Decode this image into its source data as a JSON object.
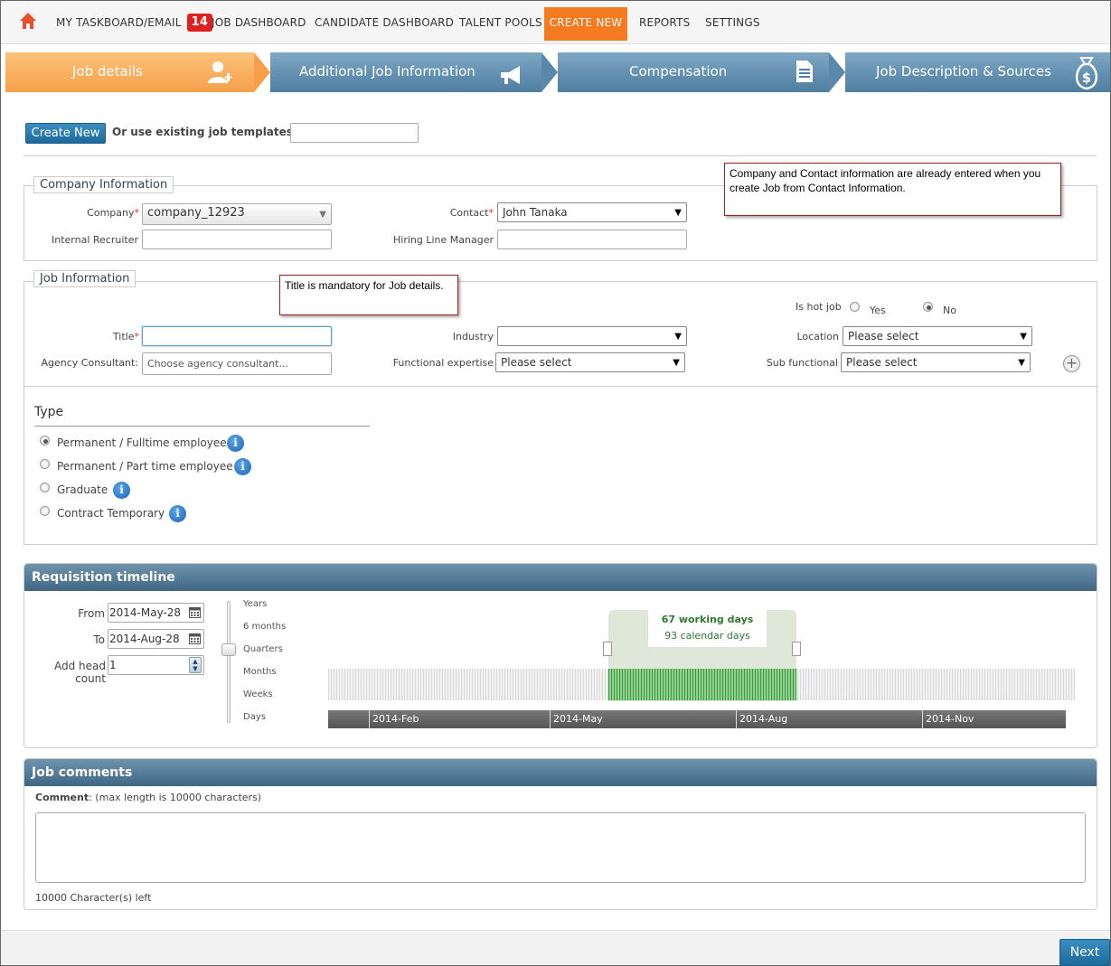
{
  "nav": {
    "home_icon": "home-icon",
    "items": [
      {
        "label": "MY TASKBOARD/EMAIL",
        "badge": "14"
      },
      {
        "label": "JOB DASHBOARD"
      },
      {
        "label": "CANDIDATE DASHBOARD"
      },
      {
        "label": "TALENT POOLS"
      },
      {
        "label": "CREATE NEW"
      },
      {
        "label": "REPORTS"
      },
      {
        "label": "SETTINGS"
      }
    ],
    "active_color": "#f47b20"
  },
  "wizard": {
    "steps": [
      {
        "label": "Job details",
        "icon": "add-user-icon",
        "active": true
      },
      {
        "label": "Additional Job Information",
        "icon": "megaphone-icon"
      },
      {
        "label": "Compensation",
        "icon": "document-icon"
      },
      {
        "label": "Job Description & Sources",
        "icon": "money-bag-icon"
      }
    ]
  },
  "templates": {
    "create_label": "Create New",
    "use_existing_label": "Or use existing job templates:"
  },
  "company_info": {
    "legend": "Company Information",
    "company_label": "Company",
    "company_value": "company_12923",
    "contact_label": "Contact",
    "contact_value": "John Tanaka",
    "recruiter_label": "Internal Recruiter",
    "manager_label": "Hiring Line Manager",
    "note": "Company and Contact information are already entered when you create Job from Contact Information."
  },
  "job_info": {
    "legend": "Job Information",
    "note": "Title is mandatory for Job details.",
    "hot_job_label": "Is hot job",
    "hot_yes": "Yes",
    "hot_no": "No",
    "title_label": "Title",
    "industry_label": "Industry",
    "location_label": "Location",
    "location_value": "Please select",
    "agency_label": "Agency Consultant:",
    "agency_placeholder": "Choose agency consultant...",
    "functional_label": "Functional expertise",
    "functional_value": "Please select",
    "subfunctional_label": "Sub functional",
    "subfunctional_value": "Please select"
  },
  "type": {
    "heading": "Type",
    "options": [
      {
        "label": "Permanent / Fulltime employee",
        "selected": true
      },
      {
        "label": "Permanent / Part time employee",
        "selected": false
      },
      {
        "label": "Graduate",
        "selected": false
      },
      {
        "label": "Contract Temporary",
        "selected": false
      }
    ]
  },
  "requisition": {
    "title": "Requisition timeline",
    "from_label": "From",
    "from_value": "2014-May-28",
    "to_label": "To",
    "to_value": "2014-Aug-28",
    "headcount_label": "Add head count",
    "headcount_value": "1",
    "scale": [
      "Years",
      "6 months",
      "Quarters",
      "Months",
      "Weeks",
      "Days"
    ],
    "working_days": "67 working days",
    "calendar_days": "93 calendar days",
    "axis_labels": [
      "2014-Feb",
      "2014-May",
      "2014-Aug",
      "2014-Nov"
    ]
  },
  "comments": {
    "title": "Job comments",
    "comment_label": "Comment",
    "comment_hint": ": (max length is 10000 characters)",
    "chars_left": "10000 Character(s) left"
  },
  "footer": {
    "next_label": "Next"
  }
}
